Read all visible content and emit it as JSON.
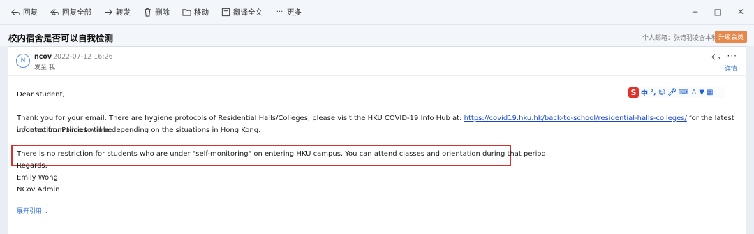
{
  "toolbar": {
    "reply": "回复",
    "reply_all": "回复全部",
    "forward": "转发",
    "delete": "删除",
    "move": "移动",
    "translate": "翻译全文",
    "more": "更多",
    "minimize": "−",
    "maximize": "□",
    "close": "✕"
  },
  "subject": {
    "title": "校内宿舍是否可以自我检测",
    "account_label": "个人邮箱：张诗羽凌含本科",
    "upgrade_label": "升级会员"
  },
  "message": {
    "avatar_letter": "N",
    "sender": "ncov",
    "date": "2022-07-12 16:26",
    "to": "发至 我",
    "more": "···",
    "detail": "详情",
    "greeting": "Dear student,",
    "para1_a": "Thank you for your email. There are hygiene protocols of Residential Halls/Colleges, please visit the HKU COVID-19 Info Hub at: ",
    "para1_link": "https://covid19.hku.hk/back-to-school/residential-halls-colleges/",
    "para1_b": " for the latest information. Policies will be",
    "para1_c": "updated from time to time depending on the situations in Hong Kong.",
    "para2": "There is no restriction for students who are under \"self-monitoring\" on entering HKU campus. You can attend classes and orientation during that period.",
    "regards": "Regards,",
    "name": "Emily Wong",
    "org": "NCov Admin",
    "expand": "展开引用 ⌄"
  },
  "ime": {
    "logo": "S",
    "lang": "中",
    "punct": "°,",
    "icons": [
      "smile-icon",
      "mic-icon",
      "keyboard-icon",
      "person-icon",
      "shirt-icon",
      "grid-icon"
    ]
  },
  "colors": {
    "accent": "#3b78d8",
    "highlight": "#d82f2f",
    "upgrade": "#e8874a"
  }
}
